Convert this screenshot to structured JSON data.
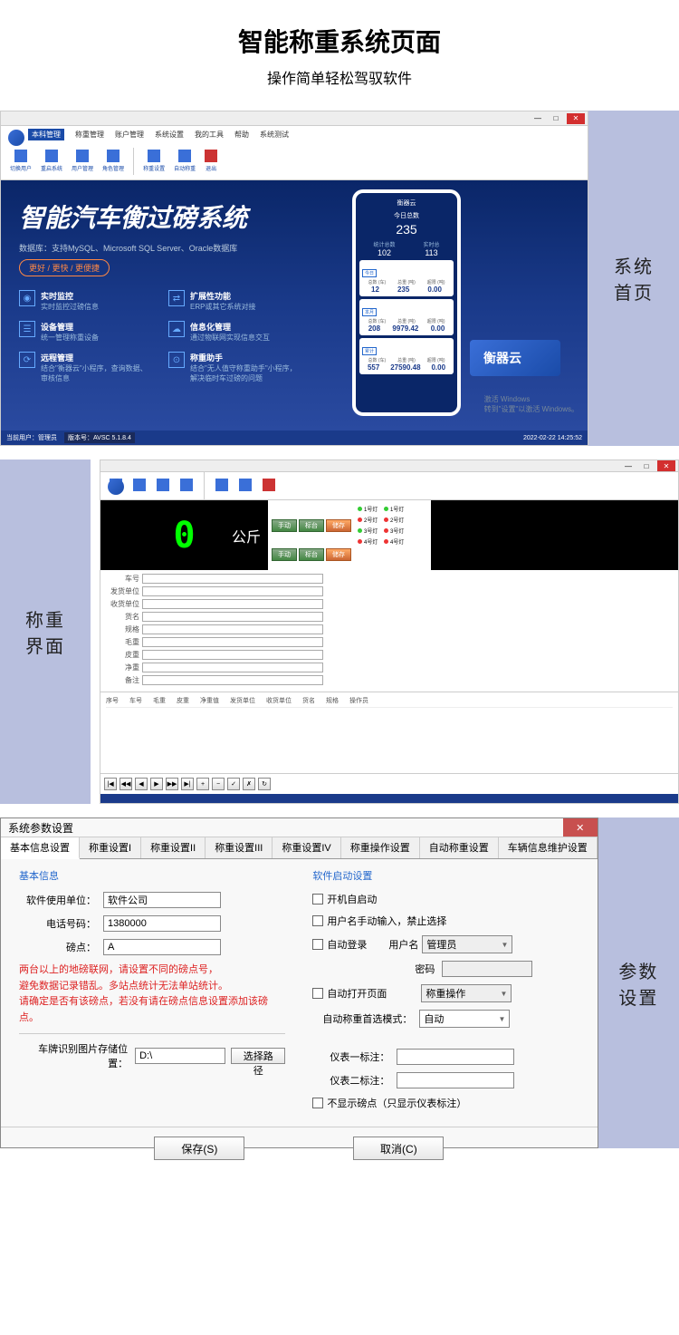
{
  "page": {
    "title": "智能称重系统页面",
    "subtitle": "操作简单轻松驾驭软件"
  },
  "labels": {
    "s1": "系统\n首页",
    "s2": "称重\n界面",
    "s3": "参数\n设置"
  },
  "s1": {
    "menu": [
      "本科管理",
      "称重管理",
      "账户管理",
      "系统设置",
      "我的工具",
      "帮助",
      "系统测试"
    ],
    "toolbar": [
      "切换用户",
      "重启系统",
      "用户管理",
      "角色管理",
      "称重设置",
      "自动称重",
      "退出"
    ],
    "toolbar_groups": [
      "账户管理",
      "系统设置"
    ],
    "heroTitle": "智能汽车衡过磅系统",
    "heroDb": "数据库：支持MySQL、Microsoft SQL Server、Oracle数据库",
    "heroBadge": "更好 / 更快 / 更便捷",
    "features": [
      {
        "icon": "◉",
        "t": "实时监控",
        "d": "实时监控过磅信息"
      },
      {
        "icon": "⇄",
        "t": "扩展性功能",
        "d": "ERP或其它系统对接"
      },
      {
        "icon": "☰",
        "t": "设备管理",
        "d": "统一管理称重设备"
      },
      {
        "icon": "☁",
        "t": "信息化管理",
        "d": "通过物联网实现信息交互"
      },
      {
        "icon": "⟳",
        "t": "远程管理",
        "d": "结合\"衡器云\"小程序，查询数据、审核信息"
      },
      {
        "icon": "⊙",
        "t": "称重助手",
        "d": "结合\"无人值守称重助手\"小程序，解决临时车过磅的问题"
      }
    ],
    "phone": {
      "brand": "衡器云",
      "todayLabel": "今日总数",
      "todayNum": "235",
      "sub1Label": "统计总数",
      "sub1": "102",
      "sub2Label": "实时总",
      "sub2": "113",
      "cards": [
        {
          "hdr": [
            "总数 (车)",
            "总重 (吨)",
            "超限 (吨)"
          ],
          "val": [
            "12",
            "235",
            "0.00"
          ],
          "tag": "今日"
        },
        {
          "hdr": [
            "总数 (车)",
            "总重 (吨)",
            "超限 (吨)"
          ],
          "val": [
            "208",
            "9979.42",
            "0.00"
          ],
          "tag": "本月"
        },
        {
          "hdr": [
            "总数 (车)",
            "总重 (吨)",
            "超限 (吨)"
          ],
          "val": [
            "557",
            "27590.48",
            "0.00"
          ],
          "tag": "累计"
        }
      ]
    },
    "truck": "衡器云",
    "activate": "激活 Windows\n转到\"设置\"以激活 Windows。",
    "footer": {
      "user": "当前用户：管理员",
      "ver": "版本号：AVSC 5.1.8.4",
      "time": "2022-02-22 14:25:52"
    }
  },
  "s2": {
    "display": "0",
    "unit": "公斤",
    "btns1": [
      "手动",
      "标台",
      "储存"
    ],
    "btns2": [
      "手动",
      "标台",
      "储存"
    ],
    "btnOrange": "储存",
    "leds": [
      {
        "c": "#3c3",
        "t": "1号灯"
      },
      {
        "c": "#3c3",
        "t": "1号灯"
      },
      {
        "c": "#e33",
        "t": "2号灯"
      },
      {
        "c": "#e33",
        "t": "2号灯"
      },
      {
        "c": "#3c3",
        "t": "3号灯"
      },
      {
        "c": "#e33",
        "t": "3号灯"
      },
      {
        "c": "#e33",
        "t": "4号灯"
      },
      {
        "c": "#e33",
        "t": "4号灯"
      }
    ],
    "formLabels": [
      "车号",
      "发货单位",
      "收货单位",
      "货名",
      "规格",
      "毛重",
      "皮重",
      "净重",
      "备注"
    ],
    "tableCols": [
      "序号",
      "车号",
      "毛重",
      "皮重",
      "净重值",
      "发货单位",
      "收货单位",
      "货名",
      "规格",
      "操作员"
    ],
    "pager": [
      "|◀",
      "◀◀",
      "◀",
      "▶",
      "▶▶",
      "▶|",
      "+",
      "−",
      "✓",
      "✗",
      "↻"
    ]
  },
  "s3": {
    "title": "系统参数设置",
    "tabs": [
      "基本信息设置",
      "称重设置I",
      "称重设置II",
      "称重设置III",
      "称重设置IV",
      "称重操作设置",
      "自动称重设置",
      "车辆信息维护设置"
    ],
    "left": {
      "legend": "基本信息",
      "unitLabel": "软件使用单位：",
      "unitVal": "软件公司",
      "phoneLabel": "电话号码：",
      "phoneVal": "1380000",
      "siteLabel": "磅点：",
      "siteVal": "A",
      "warn": "两台以上的地磅联网，请设置不同的磅点号，\n避免数据记录错乱。多站点统计无法单站统计。\n请确定是否有该磅点，若没有请在磅点信息设置添加该磅点。",
      "plateLabel": "车牌识别图片存储位置：",
      "plateVal": "D:\\",
      "browse": "选择路径"
    },
    "right": {
      "legend": "软件启动设置",
      "c1": "开机自启动",
      "c2": "用户名手动输入，禁止选择",
      "c3": "自动登录",
      "userLabel": "用户名",
      "userVal": "管理员",
      "pwdLabel": "密码",
      "c4": "自动打开页面",
      "pageVal": "称重操作",
      "modeLabel": "自动称重首选模式：",
      "modeVal": "自动",
      "m1Label": "仪表一标注：",
      "m2Label": "仪表二标注：",
      "c5": "不显示磅点（只显示仪表标注）"
    },
    "save": "保存(S)",
    "cancel": "取消(C)"
  }
}
